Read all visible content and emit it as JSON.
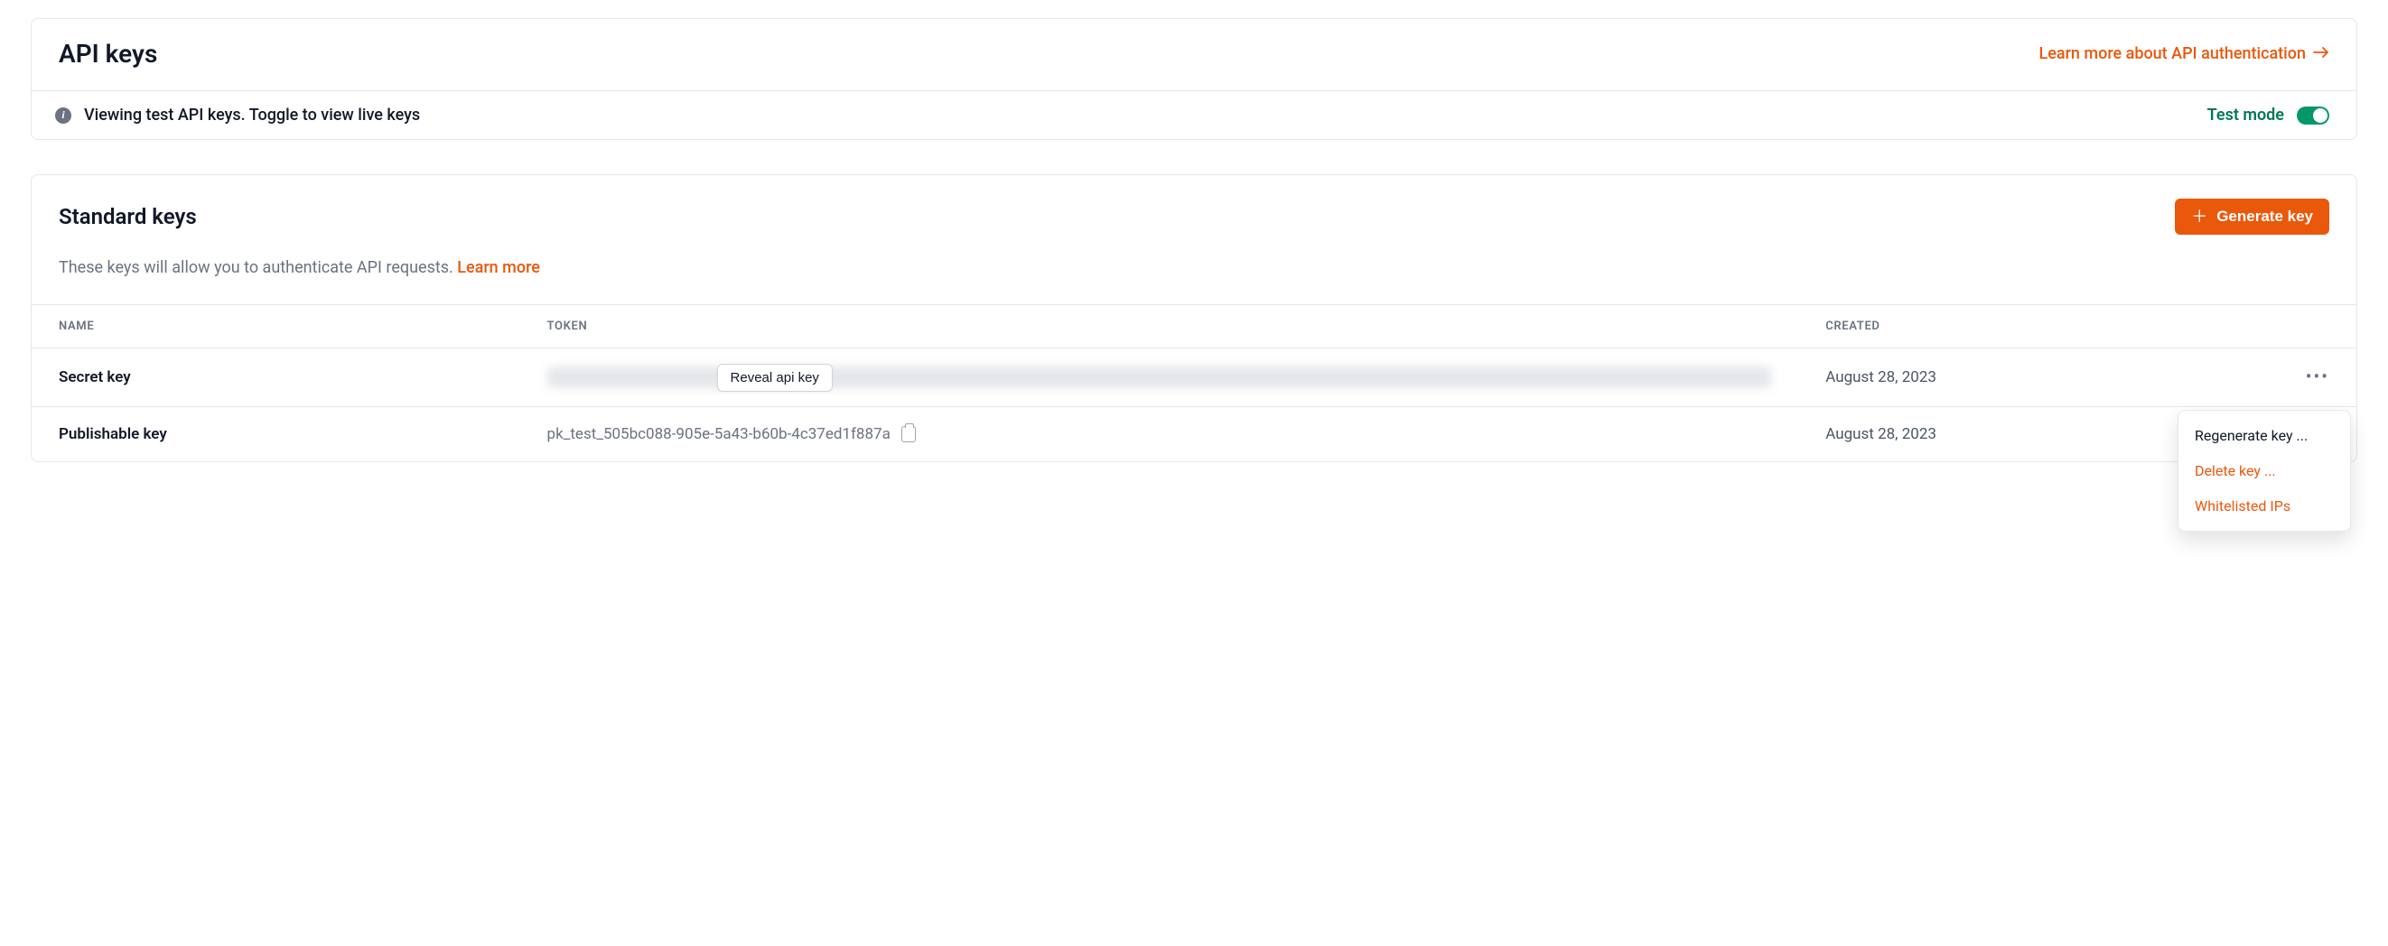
{
  "header": {
    "title": "API keys",
    "learn_more_label": "Learn more about API authentication",
    "banner_text": "Viewing test API keys. Toggle to view live keys",
    "mode_label": "Test mode",
    "mode_on": true
  },
  "keys_section": {
    "title": "Standard keys",
    "generate_label": "Generate key",
    "description_prefix": "These keys will allow you to authenticate API requests. ",
    "description_link": "Learn more",
    "columns": {
      "name": "NAME",
      "token": "TOKEN",
      "created": "CREATED"
    },
    "rows": [
      {
        "name": "Secret key",
        "token_hidden": true,
        "reveal_label": "Reveal api key",
        "created": "August 28, 2023"
      },
      {
        "name": "Publishable key",
        "token_hidden": false,
        "token": "pk_test_505bc088-905e-5a43-b60b-4c37ed1f887a",
        "created": "August 28, 2023"
      }
    ]
  },
  "dropdown": {
    "items": [
      {
        "label": "Regenerate key ...",
        "accent": false
      },
      {
        "label": "Delete key ...",
        "accent": true
      },
      {
        "label": "Whitelisted IPs",
        "accent": true
      }
    ]
  },
  "colors": {
    "accent": "#ea580c",
    "success": "#059669"
  }
}
